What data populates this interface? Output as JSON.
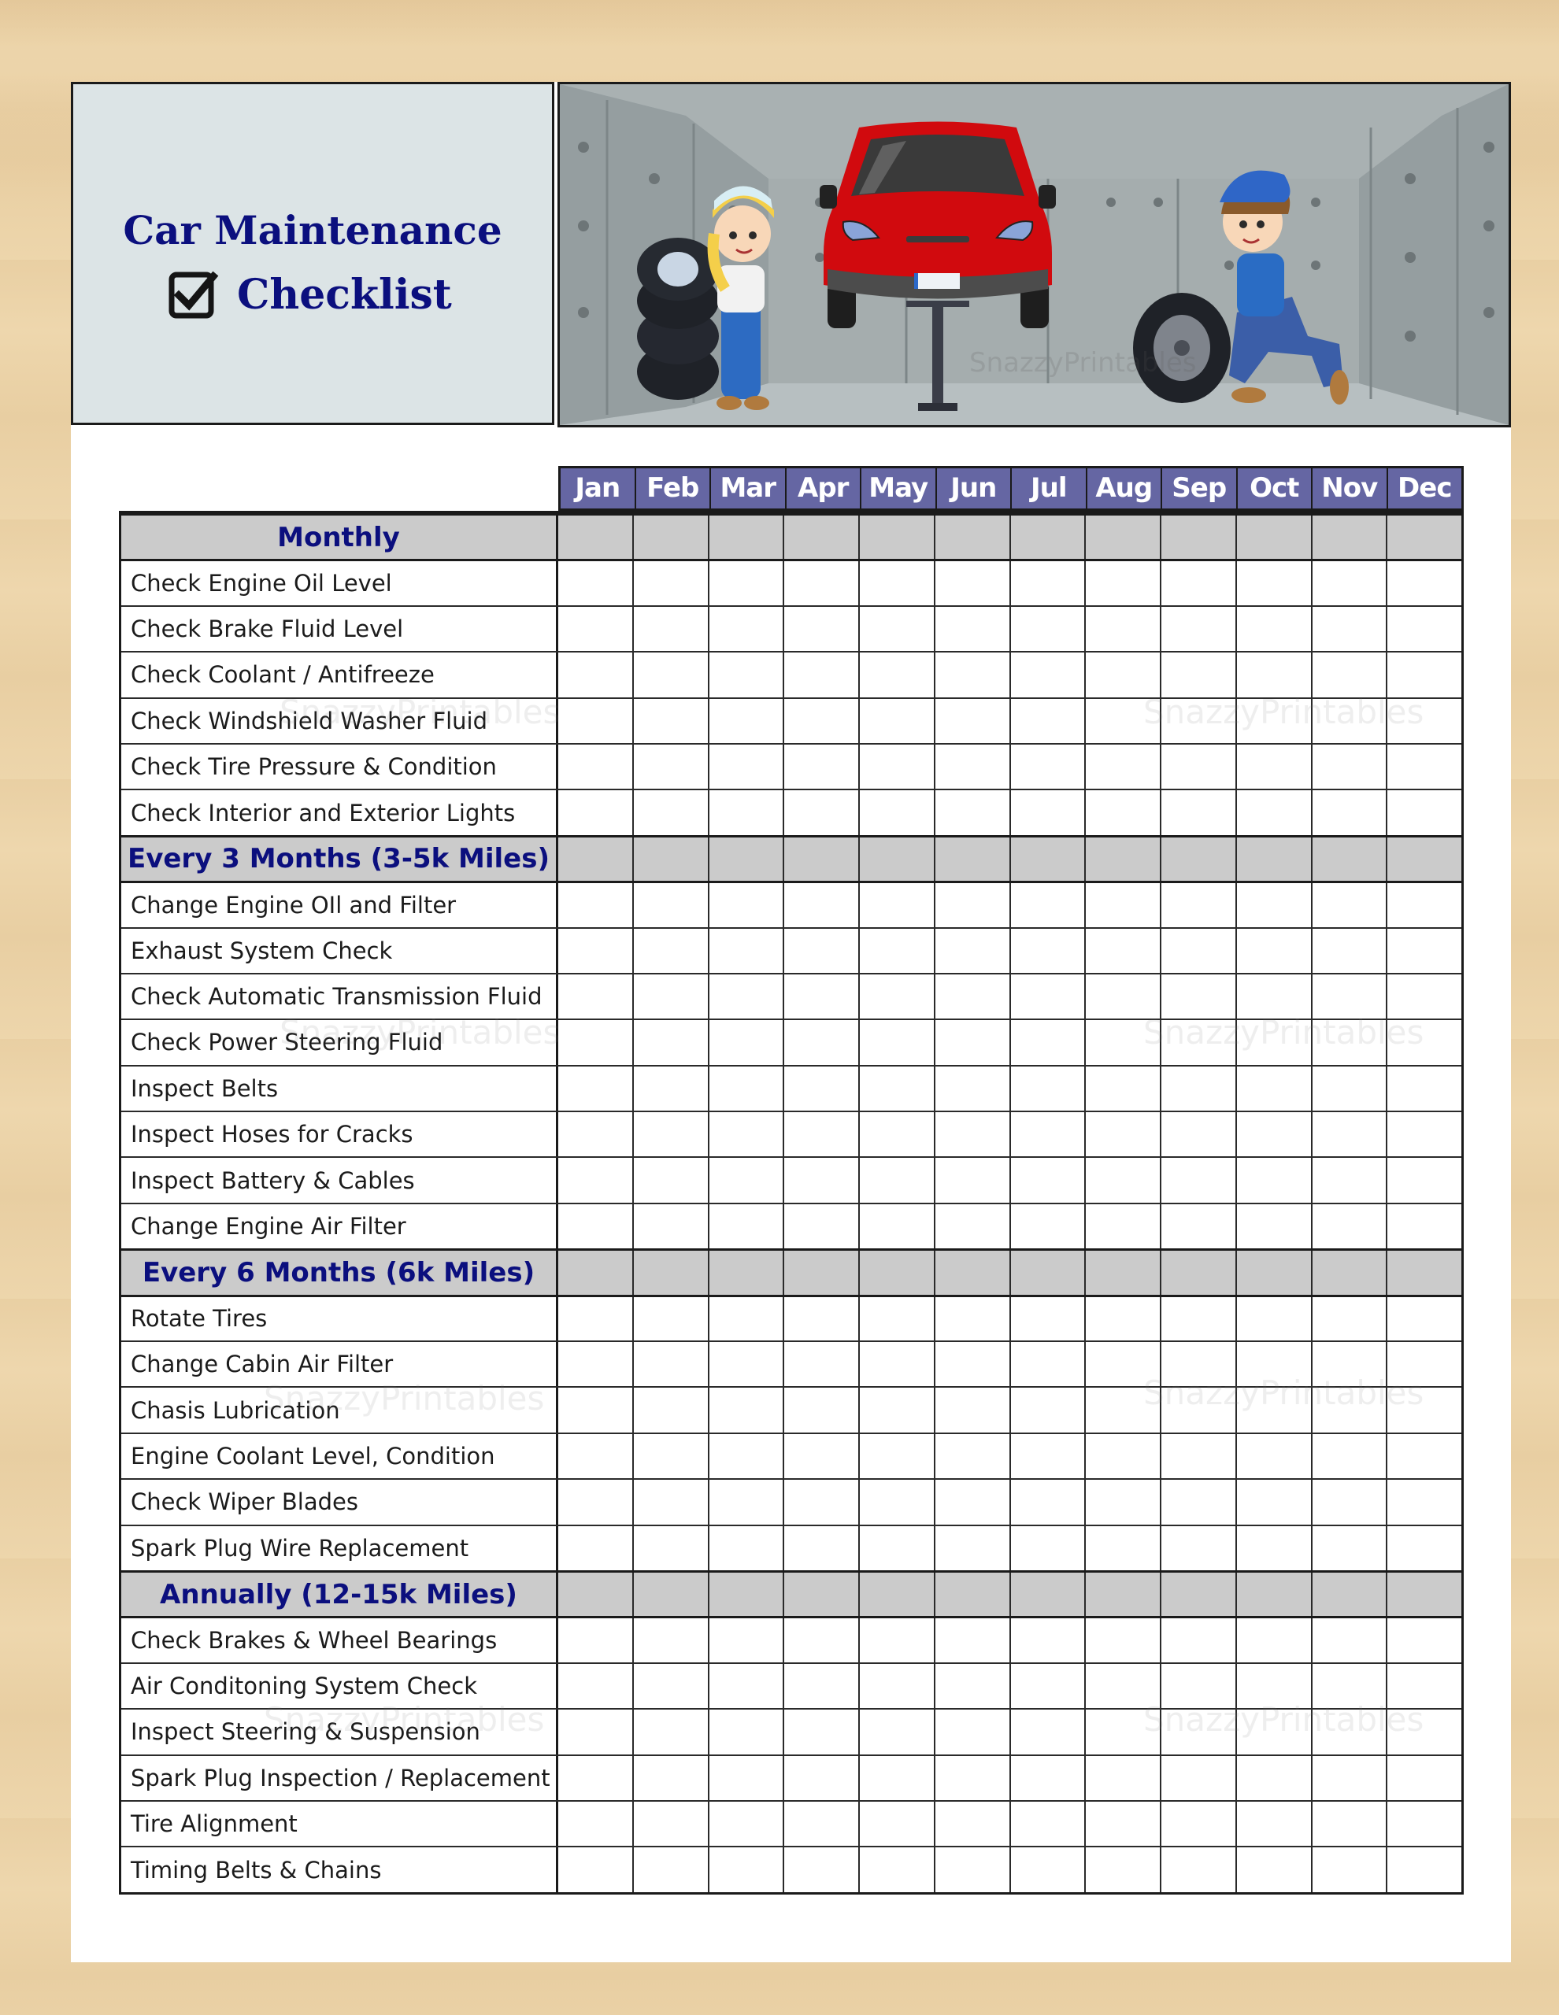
{
  "title": {
    "line1": "Car Maintenance",
    "line2": "Checklist",
    "color": "#0b0f7e"
  },
  "illustration": {
    "description": "Cartoon garage with red car on lift, girl mechanic by tire stack, boy mechanic rolling a tire",
    "watermark": "SnazzyPrintables"
  },
  "months": [
    "Jan",
    "Feb",
    "Mar",
    "Apr",
    "May",
    "Jun",
    "Jul",
    "Aug",
    "Sep",
    "Oct",
    "Nov",
    "Dec"
  ],
  "colors": {
    "month_header_bg": "#6566a3",
    "section_bg": "#cbcbcb",
    "section_text": "#0b0f7e",
    "background": "#ecd4a9"
  },
  "sections": [
    {
      "title": "Monthly",
      "items": [
        "Check Engine Oil Level",
        "Check Brake Fluid Level",
        "Check Coolant / Antifreeze",
        "Check Windshield Washer Fluid",
        "Check Tire Pressure & Condition",
        "Check Interior and Exterior Lights"
      ]
    },
    {
      "title": "Every 3 Months (3-5k Miles)",
      "items": [
        "Change Engine OIl and Filter",
        "Exhaust System Check",
        "Check Automatic Transmission Fluid",
        "Check Power Steering Fluid",
        "Inspect Belts",
        "Inspect Hoses for Cracks",
        "Inspect Battery & Cables",
        "Change Engine Air Filter"
      ]
    },
    {
      "title": "Every 6 Months (6k Miles)",
      "items": [
        "Rotate Tires",
        "Change Cabin Air Filter",
        "Chasis Lubrication",
        "Engine Coolant Level, Condition",
        "Check Wiper Blades",
        "Spark Plug Wire Replacement"
      ]
    },
    {
      "title": "Annually (12-15k Miles)",
      "items": [
        "Check Brakes & Wheel Bearings",
        "Air Conditoning System Check",
        "Inspect Steering & Suspension",
        "Spark Plug Inspection / Replacement",
        "Tire Alignment",
        "Timing Belts & Chains"
      ]
    }
  ],
  "watermark_text": "SnazzyPrintables"
}
